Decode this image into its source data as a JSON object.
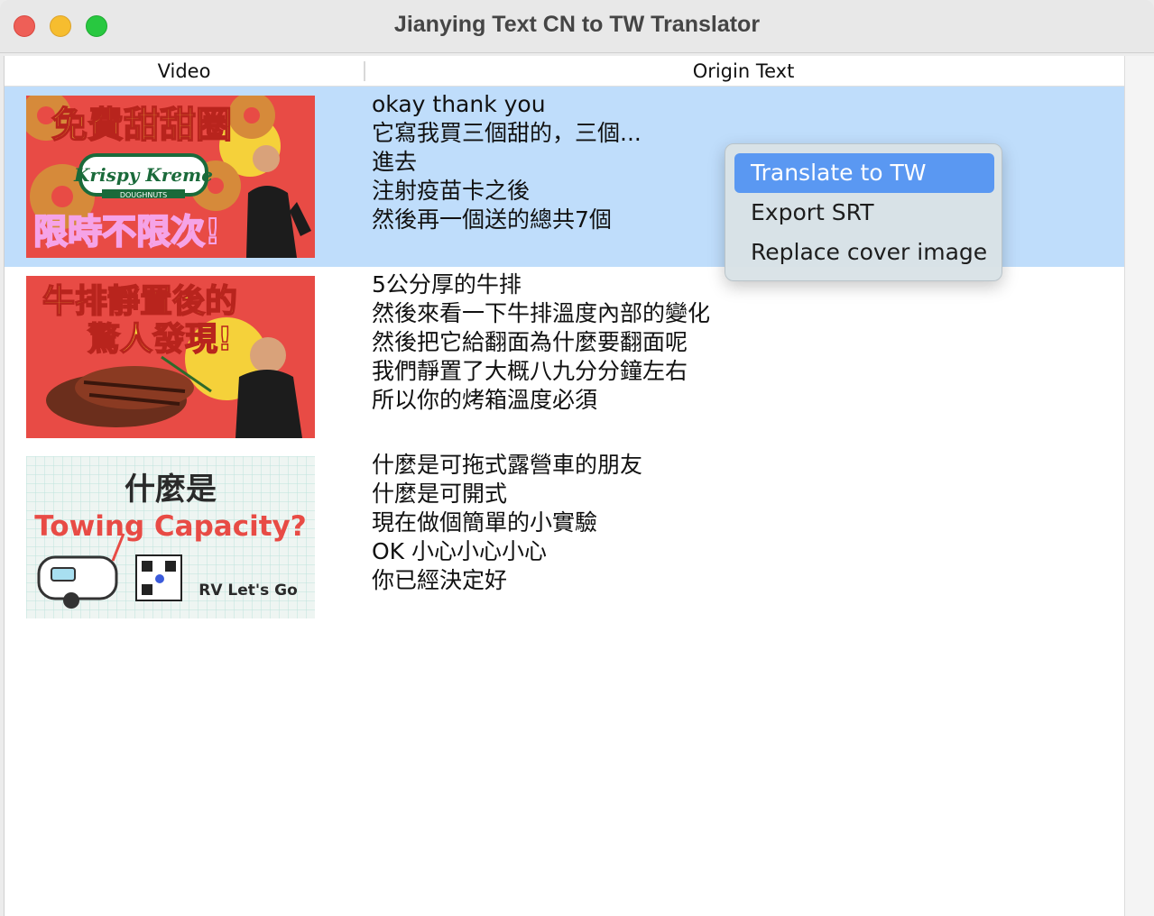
{
  "window": {
    "title": "Jianying Text CN to TW Translator"
  },
  "table": {
    "columns": {
      "video": "Video",
      "origin": "Origin Text"
    },
    "rows": [
      {
        "thumb": {
          "title": "免費甜甜圈",
          "brand": "Krispy Kreme",
          "brand_sub": "DOUGHNUTS",
          "subtitle": "限時不限次!"
        },
        "lines": [
          "okay thank you",
          "它寫我買三個甜的，三個...",
          "進去",
          "注射疫苗卡之後",
          "然後再一個送的總共7個"
        ]
      },
      {
        "thumb": {
          "title": "牛排靜置後的",
          "title2": "驚人發現!"
        },
        "lines": [
          "5公分厚的牛排",
          "然後來看一下牛排溫度內部的變化",
          "然後把它給翻面為什麼要翻面呢",
          "我們靜置了大概八九分分鐘左右",
          "所以你的烤箱溫度必須"
        ]
      },
      {
        "thumb": {
          "title": "什麼是",
          "subtitle": "Towing Capacity?",
          "brand": "RV Let's Go"
        },
        "lines": [
          "什麼是可拖式露營車的朋友",
          "什麼是可開式",
          "現在做個簡單的小實驗",
          "OK 小心小心小心",
          "你已經決定好"
        ]
      }
    ]
  },
  "context_menu": {
    "items": [
      {
        "label": "Translate to TW",
        "highlighted": true
      },
      {
        "label": "Export SRT"
      },
      {
        "label": "Replace cover image"
      }
    ]
  },
  "colors": {
    "selection": "#bfddfb",
    "menu_highlight": "#5a98f2",
    "thumb_red": "#e84b45"
  }
}
